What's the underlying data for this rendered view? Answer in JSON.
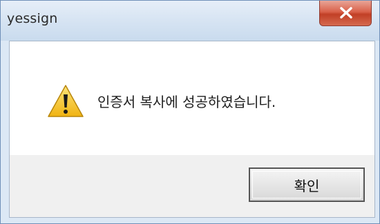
{
  "window": {
    "title": "yessign",
    "close_icon": "close-icon"
  },
  "dialog": {
    "icon": "warning-icon",
    "message": "인증서 복사에 성공하였습니다.",
    "ok_label": "확인"
  },
  "colors": {
    "titlebar": "#d5e3f2",
    "close_button": "#c13f26",
    "warning_fill": "#f5c21a",
    "button_area": "#f0f0f0"
  }
}
